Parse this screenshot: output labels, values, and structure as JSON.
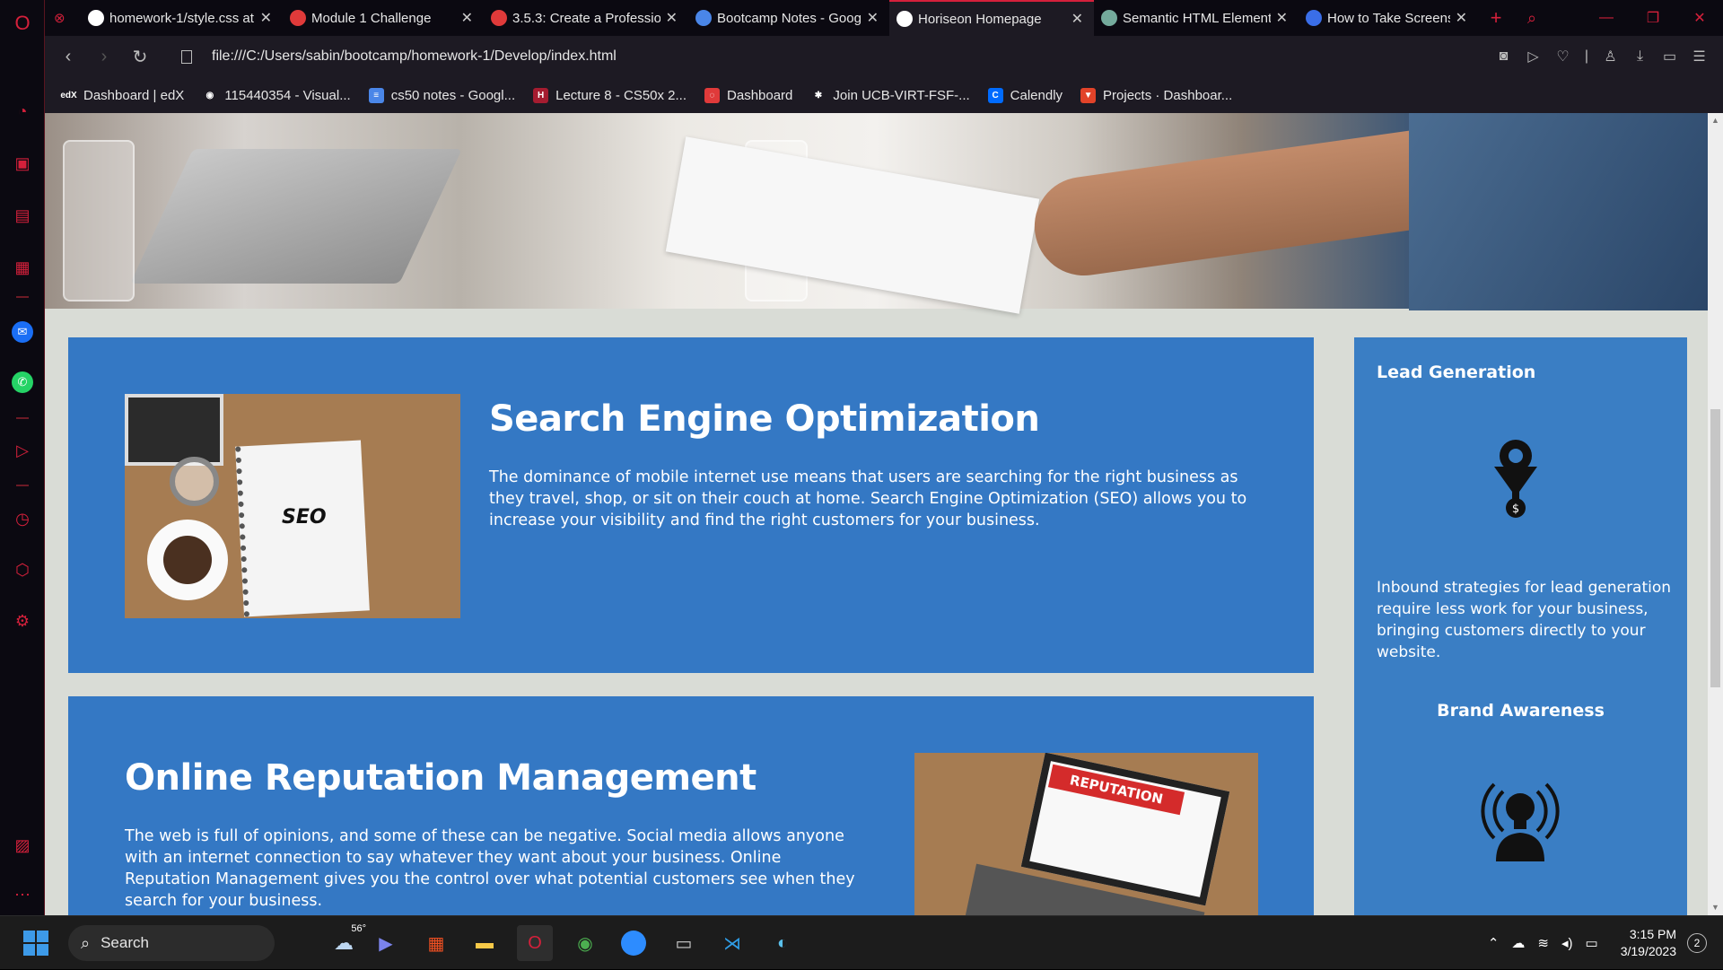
{
  "browser": {
    "tabs": [
      {
        "title": "homework-1/style.css at",
        "favicon": "github-icon",
        "color": "#ffffff",
        "active": false
      },
      {
        "title": "Module 1 Challenge",
        "favicon": "canvas-icon",
        "color": "#e03a3a",
        "active": false
      },
      {
        "title": "3.5.3: Create a Professio",
        "favicon": "canvas-icon",
        "color": "#e03a3a",
        "active": false
      },
      {
        "title": "Bootcamp Notes - Goog",
        "favicon": "google-docs-icon",
        "color": "#4a86e8",
        "active": false
      },
      {
        "title": "Horiseon Homepage",
        "favicon": "globe-icon",
        "color": "#ffffff",
        "active": true
      },
      {
        "title": "Semantic HTML Element",
        "favicon": "chatgpt-icon",
        "color": "#74aa9c",
        "active": false
      },
      {
        "title": "How to Take Screenshot",
        "favicon": "blue-square-icon",
        "color": "#3a6ee8",
        "active": false
      }
    ],
    "address": "file:///C:/Users/sabin/bootcamp/homework-1/Develop/index.html",
    "bookmarks": [
      {
        "label": "Dashboard | edX",
        "icon": "edx-icon",
        "color": "#1d1a23",
        "glyph": "edX"
      },
      {
        "label": "115440354 - Visual...",
        "icon": "github-icon",
        "color": "#1d1a23",
        "glyph": "◉"
      },
      {
        "label": "cs50 notes - Googl...",
        "icon": "google-docs-icon",
        "color": "#4a86e8",
        "glyph": "≡"
      },
      {
        "label": "Lecture 8 - CS50x 2...",
        "icon": "harvard-icon",
        "color": "#a51c30",
        "glyph": "H"
      },
      {
        "label": "Dashboard",
        "icon": "canvas-icon",
        "color": "#e03a3a",
        "glyph": "◌"
      },
      {
        "label": "Join UCB-VIRT-FSF-...",
        "icon": "slack-icon",
        "color": "#1d1a23",
        "glyph": "✱"
      },
      {
        "label": "Calendly",
        "icon": "calendly-icon",
        "color": "#006bff",
        "glyph": "C"
      },
      {
        "label": "Projects · Dashboar...",
        "icon": "gitlab-icon",
        "color": "#e24329",
        "glyph": "▼"
      }
    ],
    "accent": "#d5203b"
  },
  "page": {
    "seo": {
      "title": "Search Engine Optimization",
      "body": "The dominance of mobile internet use means that users are searching for the right business as they travel, shop, or sit on their couch at home. Search Engine Optimization (SEO) allows you to increase your visibility and find the right customers for your business.",
      "image_text": "SEO"
    },
    "orm": {
      "title": "Online Reputation Management",
      "body": "The web is full of opinions, and some of these can be negative. Social media allows anyone with an internet connection to say whatever they want about your business. Online Reputation Management gives you the control over what potential customers see when they search for your business.",
      "image_text": "REPUTATION"
    },
    "aside": {
      "lead_title": "Lead Generation",
      "lead_body": "Inbound strategies for lead generation require less work for your business, bringing customers directly to your website.",
      "brand_title": "Brand Awareness"
    },
    "colors": {
      "card": "#3478c4",
      "aside": "#3a7ec4",
      "background": "#d9dcd6"
    }
  },
  "taskbar": {
    "search_label": "Search",
    "weather": "56°",
    "time": "3:15 PM",
    "date": "3/19/2023",
    "notifications": "2"
  }
}
